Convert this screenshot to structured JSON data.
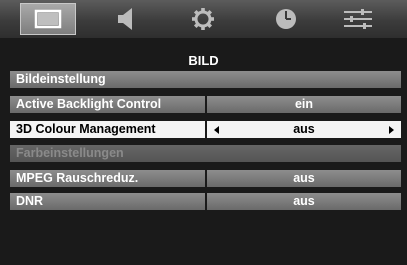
{
  "tabs": [
    {
      "icon": "picture-icon",
      "active": true
    },
    {
      "icon": "speaker-icon",
      "active": false
    },
    {
      "icon": "gear-icon",
      "active": false
    },
    {
      "icon": "clock-icon",
      "active": false
    },
    {
      "icon": "sliders-icon",
      "active": false
    }
  ],
  "menu": {
    "title": "BILD",
    "items": [
      {
        "label": "Bildeinstellung"
      },
      {
        "label": "Active Backlight Control",
        "value": "ein"
      },
      {
        "label": "3D Colour Management",
        "value": "aus",
        "selected": true
      },
      {
        "label": "Farbeinstellungen",
        "disabled": true
      },
      {
        "label": "MPEG Rauschreduz.",
        "value": "aus"
      },
      {
        "label": "DNR",
        "value": "aus"
      }
    ]
  },
  "colors": {
    "row_gray": "#7a7a7a",
    "highlight": "#f4f4f4",
    "background": "#1a1a1a"
  }
}
